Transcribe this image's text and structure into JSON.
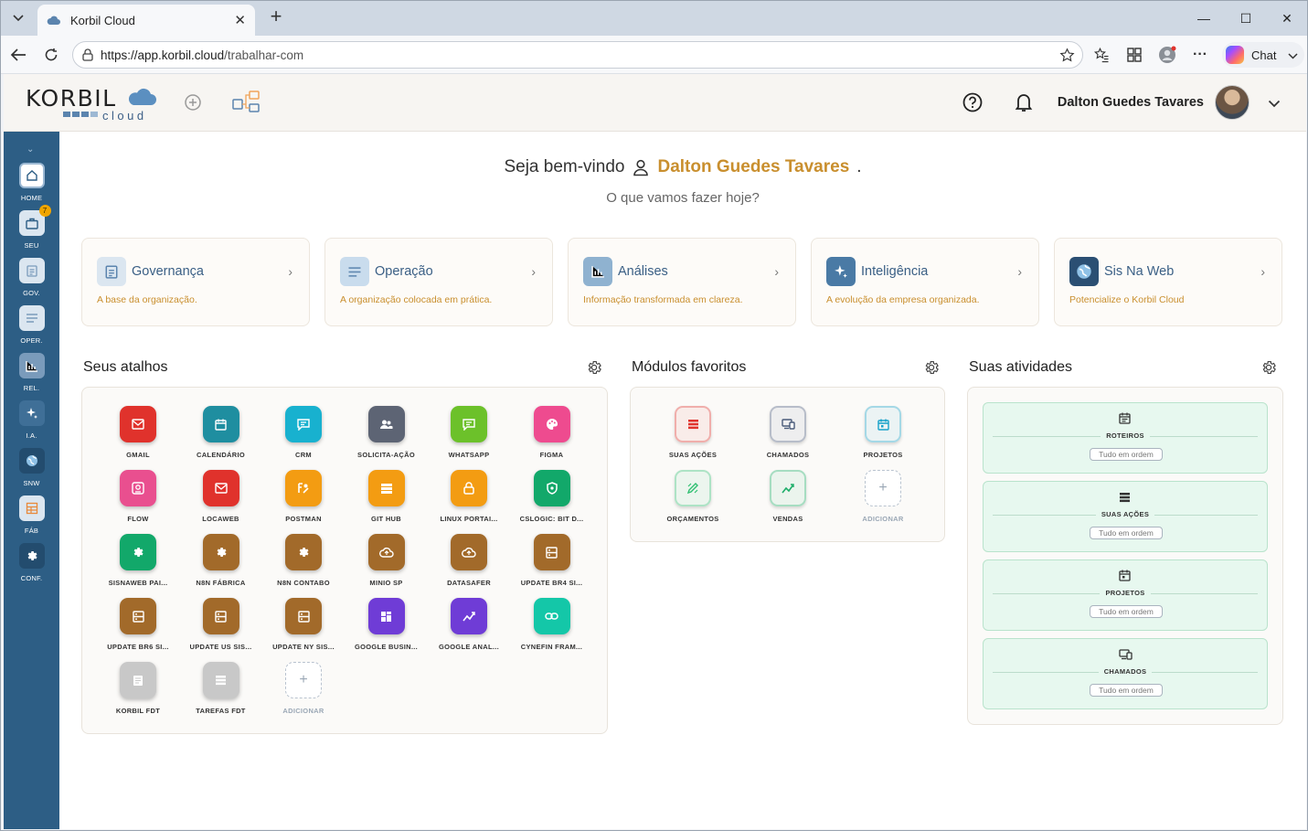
{
  "browser": {
    "tab_title": "Korbil Cloud",
    "url_host": "https://app.korbil.cloud",
    "url_path": "/trabalhar-com",
    "chat_label": "Chat"
  },
  "header": {
    "logo_main": "KORBIL",
    "logo_sub": "cloud",
    "user_name": "Dalton Guedes Tavares"
  },
  "sidebar": {
    "items": [
      {
        "label": "HOME",
        "icon": "home-icon",
        "badge": null
      },
      {
        "label": "SEU",
        "icon": "briefcase-icon",
        "badge": "7"
      },
      {
        "label": "GOV.",
        "icon": "clipboard-icon",
        "badge": null
      },
      {
        "label": "OPER.",
        "icon": "list-icon",
        "badge": null
      },
      {
        "label": "REL.",
        "icon": "bar-chart-icon",
        "badge": null
      },
      {
        "label": "I.A.",
        "icon": "sparkle-icon",
        "badge": null
      },
      {
        "label": "SNW",
        "icon": "globe-icon",
        "badge": null
      },
      {
        "label": "FÁB",
        "icon": "factory-icon",
        "badge": null
      },
      {
        "label": "CONF.",
        "icon": "gear-icon",
        "badge": null
      }
    ]
  },
  "welcome": {
    "prefix": "Seja bem-vindo",
    "name": "Dalton Guedes Tavares",
    "suffix": ".",
    "subtitle": "O que vamos fazer hoje?"
  },
  "cards": [
    {
      "title": "Governança",
      "desc": "A base da organização.",
      "color": "#dbe6f0"
    },
    {
      "title": "Operação",
      "desc": "A organização colocada em prática.",
      "color": "#c9dced"
    },
    {
      "title": "Análises",
      "desc": "Informação transformada em clareza.",
      "color": "#8fb2d0"
    },
    {
      "title": "Inteligência",
      "desc": "A evolução da empresa organizada.",
      "color": "#4a7aa5"
    },
    {
      "title": "Sis Na Web",
      "desc": "Potencialize o Korbil Cloud",
      "color": "#2b4f73"
    }
  ],
  "sections": {
    "shortcuts": "Seus atalhos",
    "favorites": "Módulos favoritos",
    "activities": "Suas atividades"
  },
  "shortcuts": [
    {
      "label": "GMAIL",
      "color": "#e0322c"
    },
    {
      "label": "CALENDÁRIO",
      "color": "#1f8ea0"
    },
    {
      "label": "CRM",
      "color": "#18b1cf"
    },
    {
      "label": "SOLICITA-AÇÃO",
      "color": "#5d6474"
    },
    {
      "label": "WHATSAPP",
      "color": "#6cc12a"
    },
    {
      "label": "FIGMA",
      "color": "#ee4b8f"
    },
    {
      "label": "FLOW",
      "color": "#e94f8f"
    },
    {
      "label": "LOCAWEB",
      "color": "#e0322c"
    },
    {
      "label": "POSTMAN",
      "color": "#f39c12"
    },
    {
      "label": "GIT HUB",
      "color": "#f39c12"
    },
    {
      "label": "LINUX PORTAI...",
      "color": "#f39c12"
    },
    {
      "label": "CSLOGIC: BIT D...",
      "color": "#12a86a"
    },
    {
      "label": "SISNAWEB PAI...",
      "color": "#12a86a"
    },
    {
      "label": "N8N FÁBRICA",
      "color": "#a26a2a"
    },
    {
      "label": "N8N CONTABO",
      "color": "#a26a2a"
    },
    {
      "label": "MINIO SP",
      "color": "#a26a2a"
    },
    {
      "label": "DATASAFER",
      "color": "#a26a2a"
    },
    {
      "label": "UPDATE BR4 SI...",
      "color": "#a26a2a"
    },
    {
      "label": "UPDATE BR6 SI...",
      "color": "#a26a2a"
    },
    {
      "label": "UPDATE US SIS...",
      "color": "#a26a2a"
    },
    {
      "label": "UPDATE NY SIS...",
      "color": "#a26a2a"
    },
    {
      "label": "GOOGLE BUSIN...",
      "color": "#6f3cd6"
    },
    {
      "label": "GOOGLE ANAL...",
      "color": "#6f3cd6"
    },
    {
      "label": "CYNEFIN FRAM...",
      "color": "#14c7a8"
    },
    {
      "label": "KORBIL FDT",
      "color": "#c8c8c8"
    },
    {
      "label": "TAREFAS FDT",
      "color": "#c8c8c8"
    }
  ],
  "add_label": "ADICIONAR",
  "favorites": [
    {
      "label": "SUAS AÇÕES",
      "color": "#e0322c"
    },
    {
      "label": "CHAMADOS",
      "color": "#4a5b7a"
    },
    {
      "label": "PROJETOS",
      "color": "#18a2c9"
    },
    {
      "label": "ORÇAMENTOS",
      "color": "#2fbf71"
    },
    {
      "label": "VENDAS",
      "color": "#1fae6a"
    }
  ],
  "activities": [
    {
      "label": "ROTEIROS",
      "status": "Tudo em ordem"
    },
    {
      "label": "SUAS AÇÕES",
      "status": "Tudo em ordem"
    },
    {
      "label": "PROJETOS",
      "status": "Tudo em ordem"
    },
    {
      "label": "CHAMADOS",
      "status": "Tudo em ordem"
    }
  ]
}
